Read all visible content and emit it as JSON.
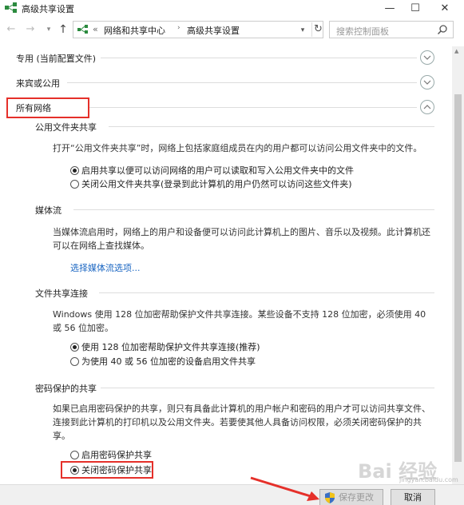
{
  "window": {
    "title": "高级共享设置",
    "minimize": "—",
    "maximize": "☐",
    "close": "✕"
  },
  "address": {
    "back": "←",
    "forward": "→",
    "up": "↑",
    "prefix": "«",
    "crumbs": [
      "网络和共享中心",
      "高级共享设置"
    ],
    "crumb_sep": "›",
    "refresh": "↻",
    "search_placeholder": "搜索控制面板"
  },
  "sections": {
    "private": "专用 (当前配置文件)",
    "guest": "来宾或公用",
    "all": "所有网络"
  },
  "public_folder": {
    "heading": "公用文件夹共享",
    "desc": "打开“公用文件夹共享”时，网络上包括家庭组成员在内的用户都可以访问公用文件夹中的文件。",
    "opt_on": "启用共享以便可以访问网络的用户可以读取和写入公用文件夹中的文件",
    "opt_off": "关闭公用文件夹共享(登录到此计算机的用户仍然可以访问这些文件夹)"
  },
  "media": {
    "heading": "媒体流",
    "desc": "当媒体流启用时，网络上的用户和设备便可以访问此计算机上的图片、音乐以及视频。此计算机还可以在网络上查找媒体。",
    "link": "选择媒体流选项..."
  },
  "file_sharing": {
    "heading": "文件共享连接",
    "desc": "Windows 使用 128 位加密帮助保护文件共享连接。某些设备不支持 128 位加密，必须使用 40 或 56 位加密。",
    "opt_128": "使用 128 位加密帮助保护文件共享连接(推荐)",
    "opt_40": "为使用 40 或 56 位加密的设备启用文件共享"
  },
  "password": {
    "heading": "密码保护的共享",
    "desc": "如果已启用密码保护的共享，则只有具备此计算机的用户帐户和密码的用户才可以访问共享文件、连接到此计算机的打印机以及公用文件夹。若要使其他人具备访问权限，必须关闭密码保护的共享。",
    "opt_on": "启用密码保护共享",
    "opt_off": "关闭密码保护共享"
  },
  "buttons": {
    "save": "保存更改",
    "cancel": "取消"
  },
  "watermark": {
    "text": "Bai 经验",
    "sub": "jingyan.baidu.com"
  },
  "colors": {
    "highlight": "#e5302a",
    "link": "#1a66c2"
  }
}
